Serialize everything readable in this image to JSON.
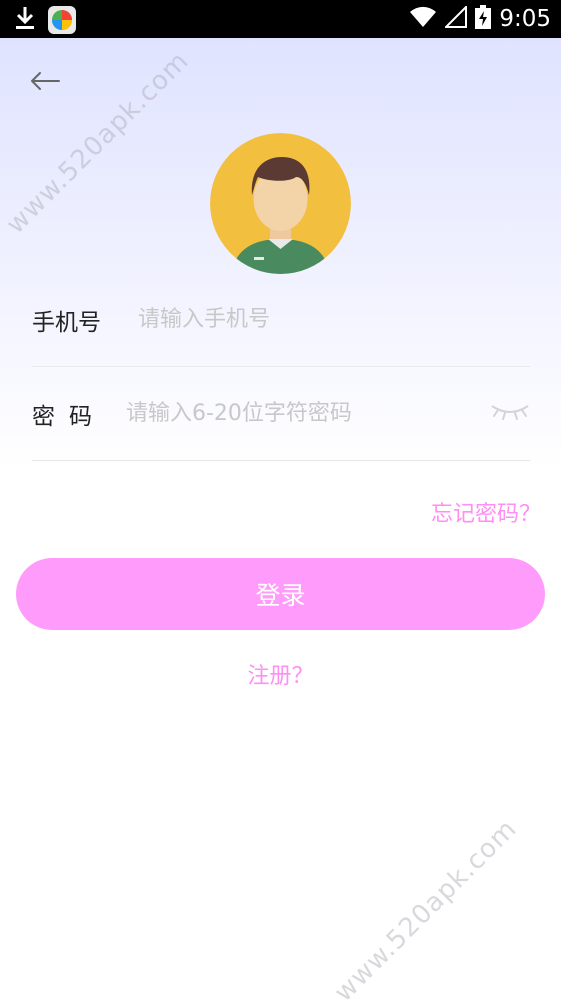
{
  "status_bar": {
    "time": "9:05",
    "icons": [
      "download-icon",
      "app-icon",
      "wifi-icon",
      "signal-icon",
      "battery-charging-icon"
    ]
  },
  "nav": {
    "back_icon": "arrow-left-icon"
  },
  "form": {
    "phone_label": "手机号",
    "phone_placeholder": "请输入手机号",
    "password_label": "密码",
    "password_placeholder": "请输入6-20位字符密码",
    "eye_icon": "eye-closed-icon"
  },
  "forgot_password": "忘记密码？",
  "login_button": "登录",
  "register_link": "注册？",
  "watermark": "www.520apk.com",
  "colors": {
    "accent": "#ff9cfb",
    "link": "#ff8ef5",
    "avatar_bg": "#f3bf3f",
    "header_gradient_top": "#dfe3ff"
  }
}
